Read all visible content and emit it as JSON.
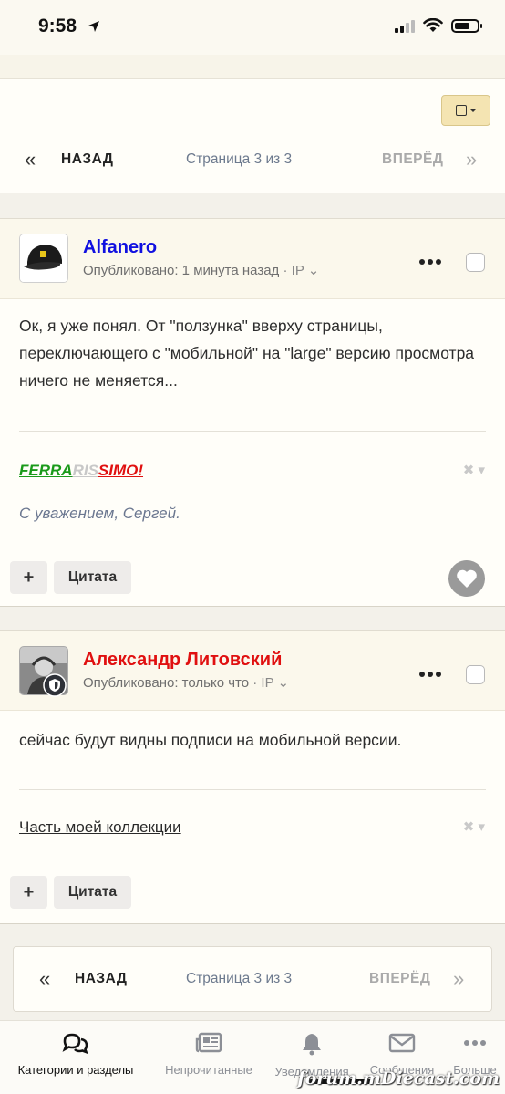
{
  "status_bar": {
    "time": "9:58"
  },
  "pager": {
    "first": "«",
    "prev": "НАЗАД",
    "page_text": "Страница 3 из 3",
    "next": "ВПЕРЁД",
    "last": "»"
  },
  "posts": [
    {
      "author": "Alfanero",
      "author_color": "#1010e0",
      "meta": "Опубликовано: 1 минута назад",
      "ip": "· IP",
      "body": "Ок, я уже понял. От \"ползунка\" вверху страницы, переключающего с \"мобильной\" на \"large\" версию просмотра ничего не меняется...",
      "signature": {
        "part1": "FERRA",
        "part2": "RIS",
        "part3": "SIMO!",
        "greeting": "С уважением, Сергей."
      }
    },
    {
      "author": "Александр Литовский",
      "author_color": "#e01010",
      "meta": "Опубликовано: только что",
      "ip": "· IP",
      "body": "сейчас будут видны подписи на мобильной версии.",
      "signature": {
        "link": "Часть моей коллекции"
      }
    }
  ],
  "actions": {
    "plus": "+",
    "quote": "Цитата"
  },
  "tabbar": {
    "items": [
      {
        "label": "Категории и разделы",
        "icon": "chat-bubbles-icon"
      },
      {
        "label": "Непрочитанные",
        "icon": "newspaper-icon"
      },
      {
        "label": "Уведомления",
        "icon": "bell-icon"
      },
      {
        "label": "Сообщения",
        "icon": "envelope-icon"
      },
      {
        "label": "Больше",
        "icon": "more-dots-icon"
      }
    ]
  },
  "watermark": "forum.mDiecast.com"
}
